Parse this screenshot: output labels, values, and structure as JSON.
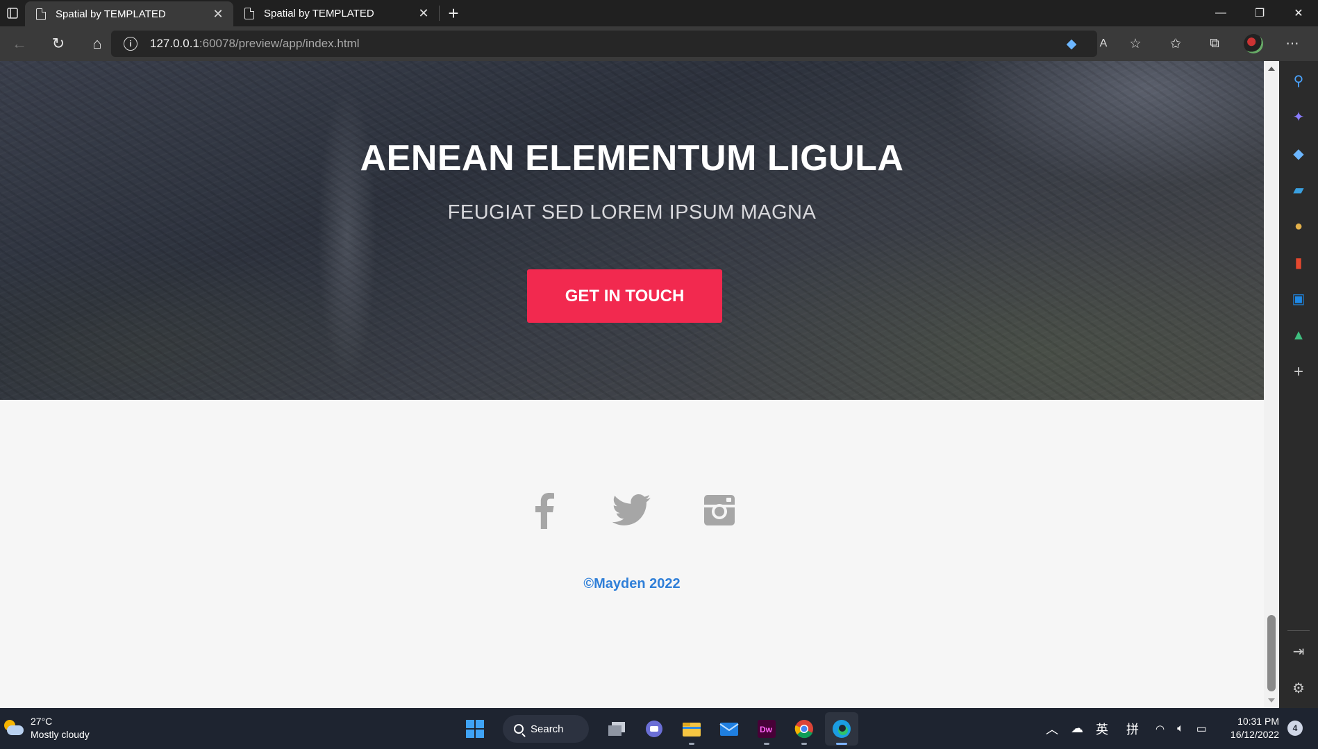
{
  "browser": {
    "tabs": [
      {
        "title": "Spatial by TEMPLATED",
        "active": true
      },
      {
        "title": "Spatial by TEMPLATED",
        "active": false
      }
    ],
    "url_host": "127.0.0.1",
    "url_path": ":60078/preview/app/index.html"
  },
  "page": {
    "banner_title": "AENEAN ELEMENTUM LIGULA",
    "banner_subtitle": "FEUGIAT SED LOREM IPSUM MAGNA",
    "cta_label": "GET IN TOUCH",
    "social_icons": [
      "facebook-icon",
      "twitter-icon",
      "instagram-icon"
    ],
    "copyright": "©Mayden 2022",
    "colors": {
      "cta": "#f2294f",
      "copyright": "#2f7fd8",
      "social": "#a6a6a6"
    }
  },
  "taskbar": {
    "weather_temp": "27°C",
    "weather_desc": "Mostly cloudy",
    "search_label": "Search",
    "ime_lang": "英",
    "ime_mode": "拼",
    "time": "10:31 PM",
    "date": "16/12/2022",
    "notification_count": "4"
  }
}
